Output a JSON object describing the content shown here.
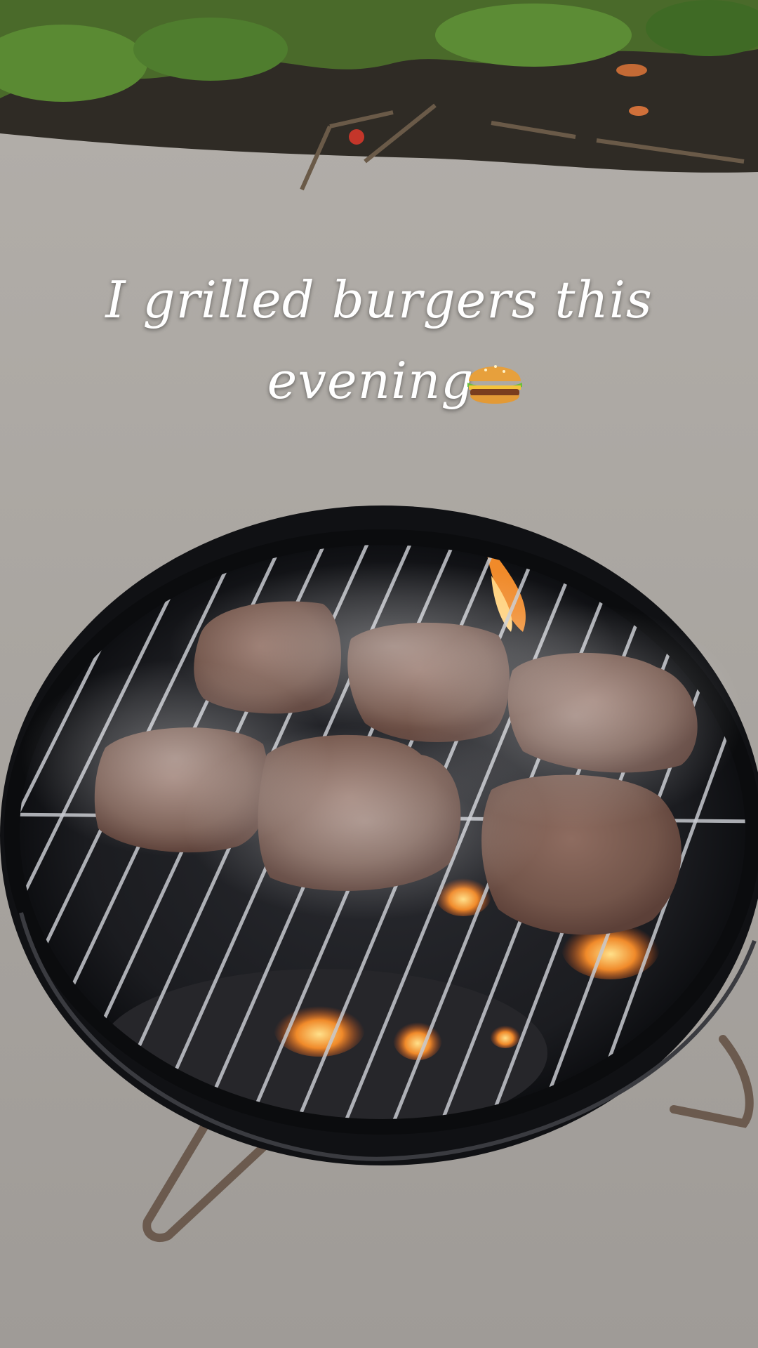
{
  "caption": {
    "line1": "I grilled burgers this",
    "line2": "evening."
  },
  "icons": {
    "sticker": "hamburger-emoji-icon"
  },
  "colors": {
    "caption_text": "#ffffff",
    "concrete": "#a8a49f",
    "grill_rim": "#111214",
    "patty": "#7a5a4e",
    "flame": "#f08a2a"
  }
}
